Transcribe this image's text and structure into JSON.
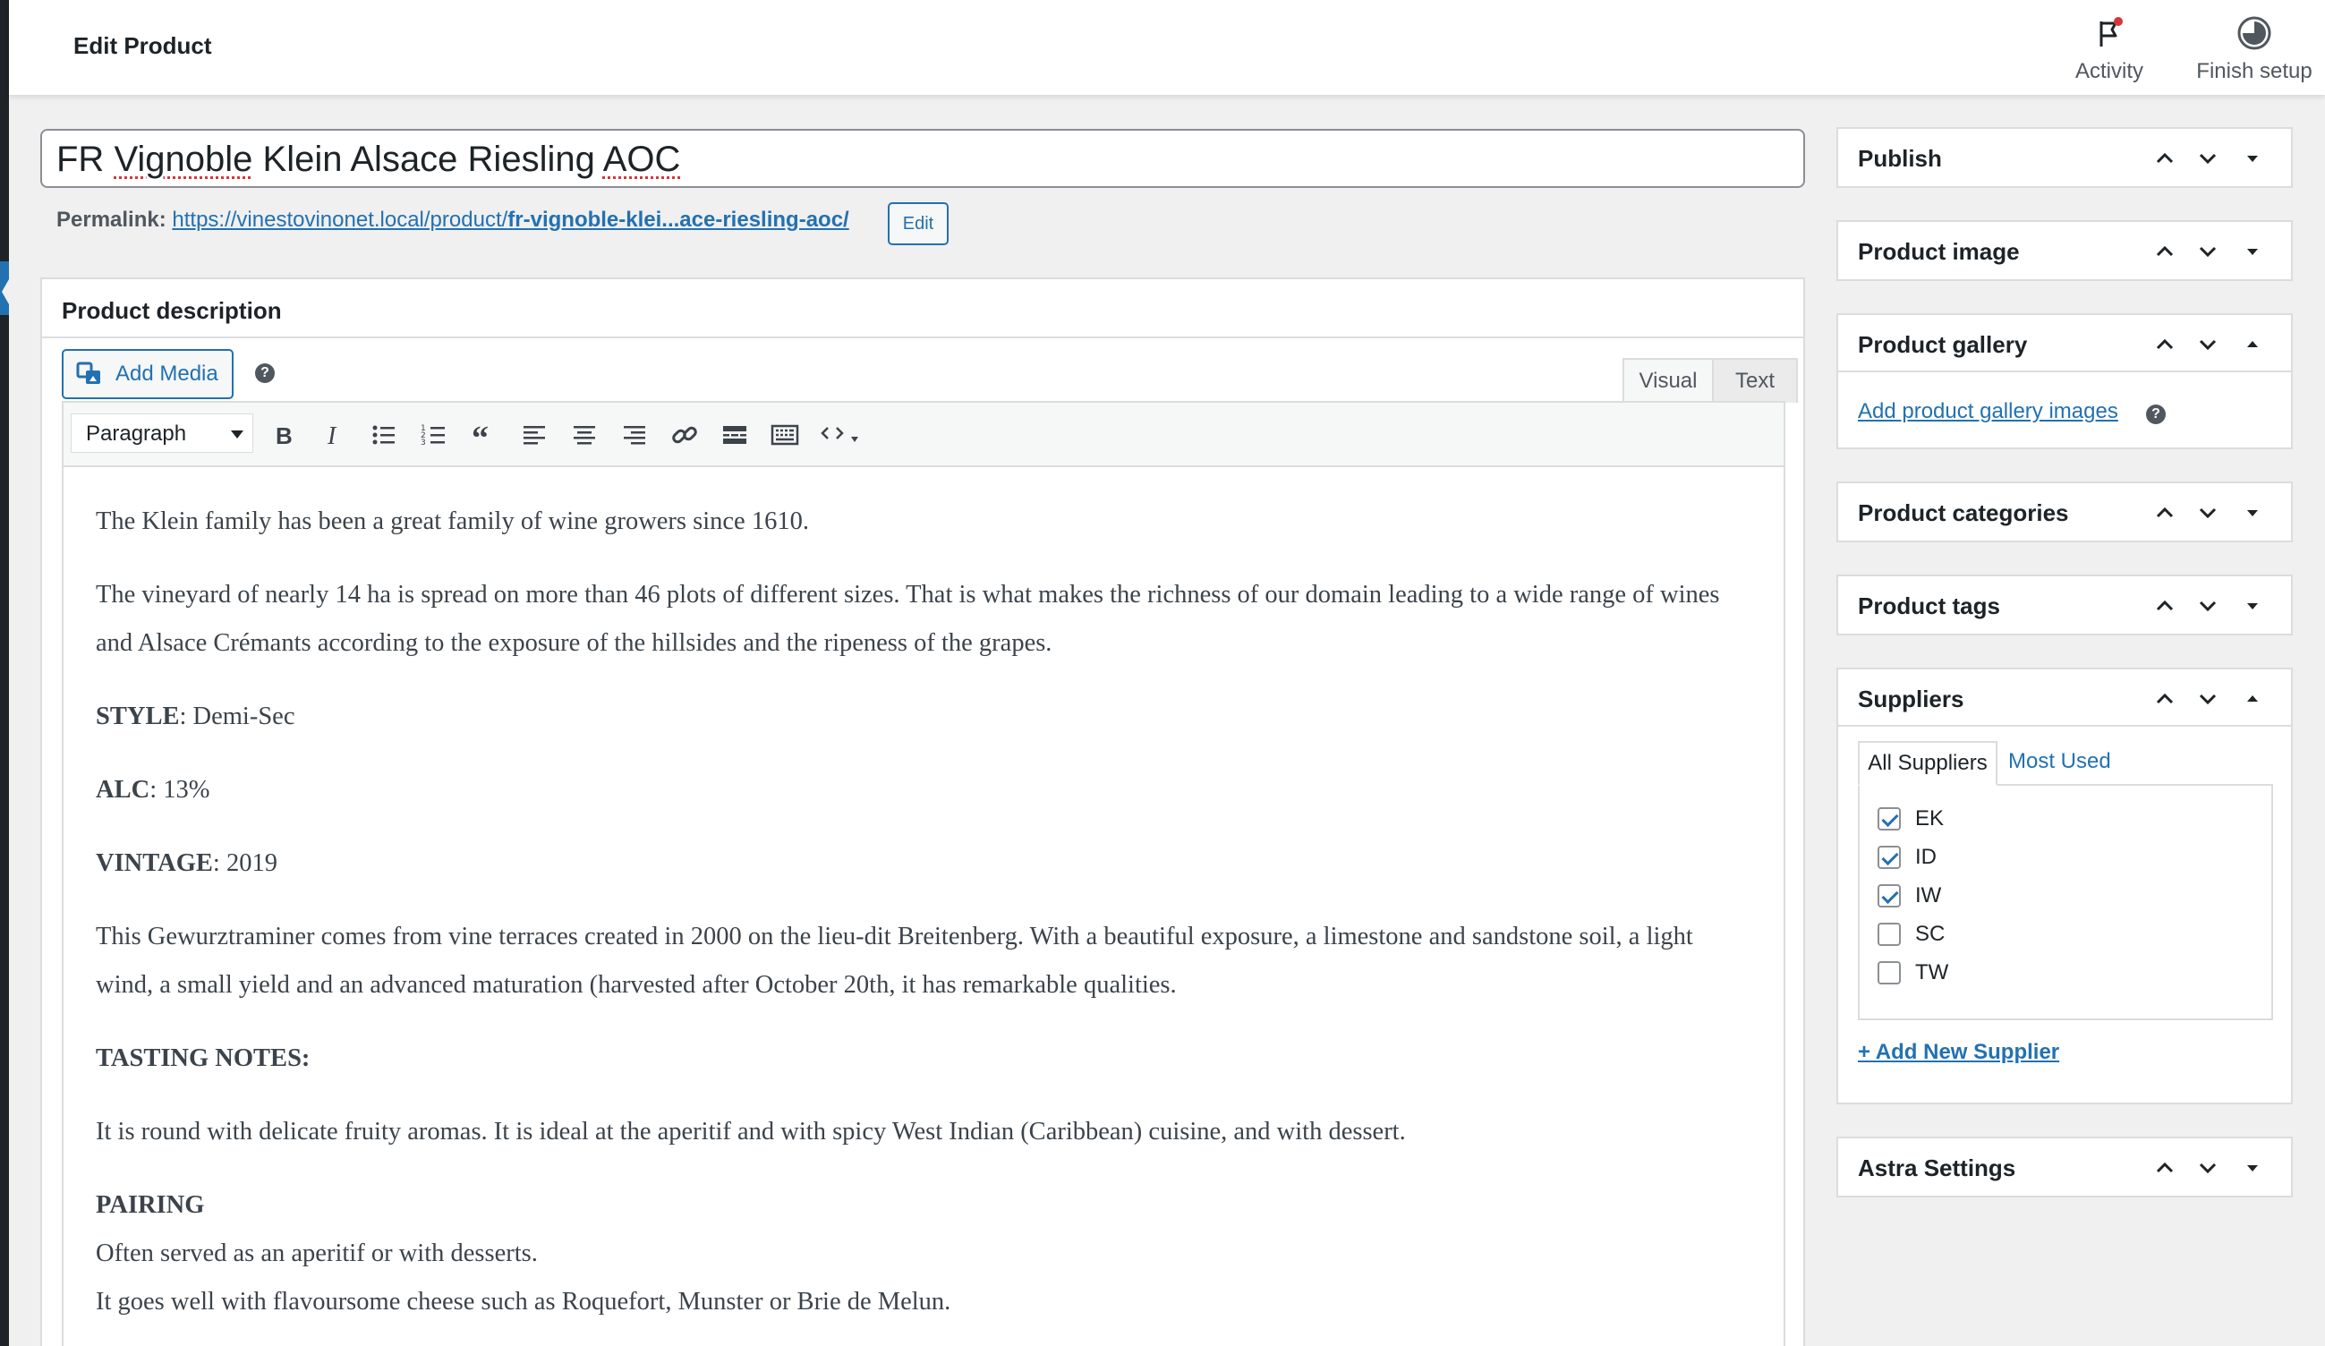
{
  "header": {
    "title": "Edit Product",
    "activity_label": "Activity",
    "finish_setup_label": "Finish setup"
  },
  "post_title": {
    "words": [
      "FR ",
      "Vignoble",
      " Klein Alsace Riesling ",
      "AOC"
    ]
  },
  "permalink": {
    "label": "Permalink:",
    "url_base": "https://vinestovinonet.local/product/",
    "url_slug": "fr-vignoble-klei...ace-riesling-aoc/",
    "edit_label": "Edit"
  },
  "description": {
    "heading": "Product description",
    "add_media_label": "Add Media",
    "help_glyph": "?",
    "tab_visual": "Visual",
    "tab_text": "Text",
    "format_select": "Paragraph",
    "paragraphs": {
      "p1": "The Klein family has been a great family of wine growers since 1610.",
      "p2": "The vineyard of nearly 14 ha is spread on more than 46 plots of different sizes. That is what makes the richness of our domain leading to a wide range of wines and Alsace Crémants according to the exposure of the hillsides and the ripeness of the grapes.",
      "style_label": "STYLE",
      "style_value": ": Demi-Sec",
      "alc_label": "ALC",
      "alc_value": ": 13%",
      "vintage_label": "VINTAGE",
      "vintage_value": ": 2019",
      "p3": "This Gewurztraminer comes from vine terraces created in 2000 on the lieu-dit Breitenberg. With a beautiful exposure, a limestone and sandstone soil, a light wind, a small yield and an advanced maturation (harvested after October 20th, it has remarkable qualities.",
      "tasting_label": "TASTING NOTES:",
      "p4": "It is round with delicate fruity aromas. It is ideal at the aperitif and with spicy West Indian (Caribbean) cuisine, and with dessert.",
      "pairing_label": "PAIRING",
      "pairing_line1": "Often served as an aperitif or with desserts.",
      "pairing_line2": "It goes well with flavoursome cheese such as Roquefort, Munster or Brie de Melun."
    }
  },
  "sidebar": {
    "publish": "Publish",
    "product_image": "Product image",
    "product_gallery": "Product gallery",
    "add_gallery_images": "Add product gallery images",
    "product_categories": "Product categories",
    "product_tags": "Product tags",
    "suppliers": {
      "title": "Suppliers",
      "tab_all": "All Suppliers",
      "tab_most_used": "Most Used",
      "items": [
        {
          "label": "EK",
          "checked": true
        },
        {
          "label": "ID",
          "checked": true
        },
        {
          "label": "IW",
          "checked": true
        },
        {
          "label": "SC",
          "checked": false
        },
        {
          "label": "TW",
          "checked": false
        }
      ],
      "add_new": "+ Add New Supplier"
    },
    "astra_settings": "Astra Settings"
  },
  "colors": {
    "accent": "#2271b1",
    "text": "#1d2327",
    "border": "#dcdcde",
    "background": "#f0f0f1",
    "notification_dot": "#d63638"
  }
}
